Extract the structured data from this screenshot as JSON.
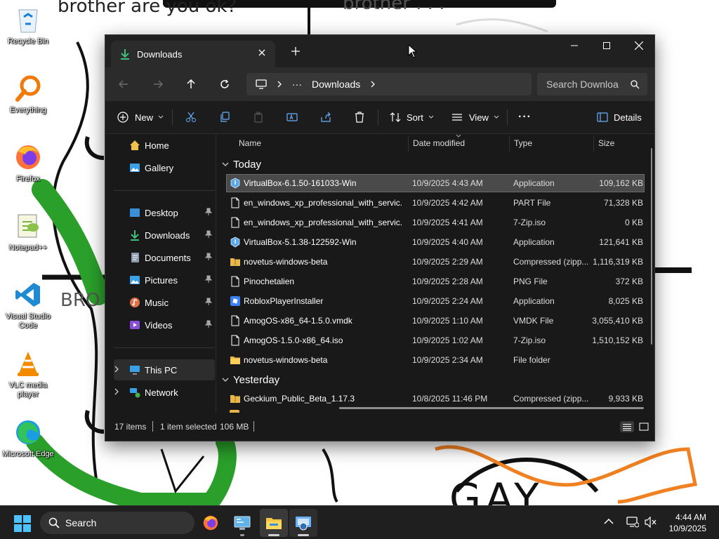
{
  "desktop": {
    "wall_text_1": "brother are you ok?",
    "wall_text_2": "brother . . .",
    "wall_text_3": "BRO",
    "wall_text_4": "GAY",
    "icons": [
      {
        "label": "Recycle Bin",
        "icon": "recycle-bin-icon"
      },
      {
        "label": "Everything",
        "icon": "magnifier-icon"
      },
      {
        "label": "Firefox",
        "icon": "firefox-icon"
      },
      {
        "label": "Notepad++",
        "icon": "notepadpp-icon"
      },
      {
        "label": "Visual Studio Code",
        "icon": "vscode-icon"
      },
      {
        "label": "VLC media player",
        "icon": "vlc-icon"
      },
      {
        "label": "Microsoft Edge",
        "icon": "edge-icon"
      }
    ]
  },
  "window": {
    "tab_title": "Downloads",
    "breadcrumb_more": "···",
    "breadcrumb_current": "Downloads",
    "search_placeholder": "Search Downloa"
  },
  "toolbar": {
    "new_label": "New",
    "sort_label": "Sort",
    "view_label": "View",
    "more_label": "···",
    "details_label": "Details"
  },
  "nav": {
    "home": "Home",
    "gallery": "Gallery",
    "desktop": "Desktop",
    "downloads": "Downloads",
    "documents": "Documents",
    "pictures": "Pictures",
    "music": "Music",
    "videos": "Videos",
    "this_pc": "This PC",
    "network": "Network"
  },
  "columns": {
    "name": "Name",
    "date": "Date modified",
    "type": "Type",
    "size": "Size"
  },
  "groups": {
    "today": "Today",
    "yesterday": "Yesterday"
  },
  "files": [
    {
      "name": "VirtualBox-6.1.50-161033-Win",
      "date": "10/9/2025 4:43 AM",
      "type": "Application",
      "size": "109,162 KB",
      "icon": "installer-icon"
    },
    {
      "name": "en_windows_xp_professional_with_servic...",
      "date": "10/9/2025 4:42 AM",
      "type": "PART File",
      "size": "71,328 KB",
      "icon": "file-icon"
    },
    {
      "name": "en_windows_xp_professional_with_servic...",
      "date": "10/9/2025 4:41 AM",
      "type": "7-Zip.iso",
      "size": "0 KB",
      "icon": "file-icon"
    },
    {
      "name": "VirtualBox-5.1.38-122592-Win",
      "date": "10/9/2025 4:40 AM",
      "type": "Application",
      "size": "121,641 KB",
      "icon": "installer-icon"
    },
    {
      "name": "novetus-windows-beta",
      "date": "10/9/2025 2:29 AM",
      "type": "Compressed (zipp...",
      "size": "1,116,319 KB",
      "icon": "zip-folder-icon"
    },
    {
      "name": "Pinochetalien",
      "date": "10/9/2025 2:28 AM",
      "type": "PNG File",
      "size": "372 KB",
      "icon": "image-file-icon"
    },
    {
      "name": "RobloxPlayerInstaller",
      "date": "10/9/2025 2:24 AM",
      "type": "Application",
      "size": "8,025 KB",
      "icon": "roblox-icon"
    },
    {
      "name": "AmogOS-x86_64-1.5.0.vmdk",
      "date": "10/9/2025 1:10 AM",
      "type": "VMDK File",
      "size": "3,055,410 KB",
      "icon": "file-icon"
    },
    {
      "name": "AmogOS-1.5.0-x86_64.iso",
      "date": "10/9/2025 1:02 AM",
      "type": "7-Zip.iso",
      "size": "1,510,152 KB",
      "icon": "file-icon"
    },
    {
      "name": "novetus-windows-beta",
      "date": "10/9/2025 2:34 AM",
      "type": "File folder",
      "size": "",
      "icon": "folder-icon"
    },
    {
      "name": "Geckium_Public_Beta_1.17.3",
      "date": "10/8/2025 11:46 PM",
      "type": "Compressed (zipp...",
      "size": "9,933 KB",
      "icon": "zip-folder-icon"
    }
  ],
  "status": {
    "items": "17 items",
    "selected": "1 item selected",
    "size": "106 MB"
  },
  "taskbar": {
    "search_label": "Search",
    "time": "4:44 AM",
    "date": "10/9/2025"
  }
}
